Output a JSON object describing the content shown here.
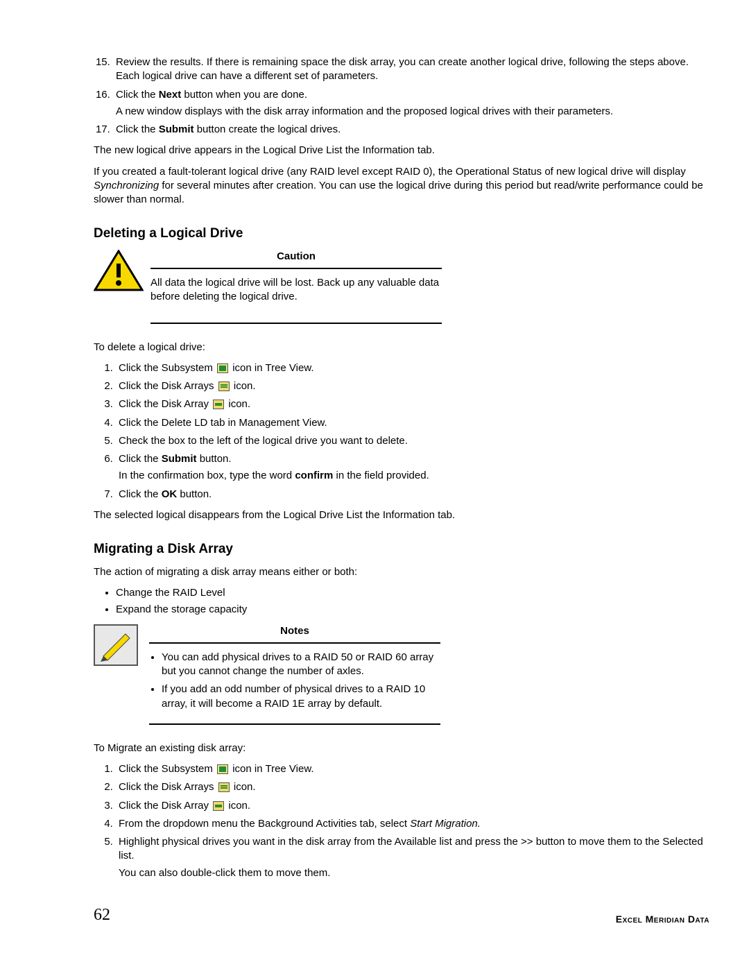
{
  "steps_top": {
    "start": 15,
    "items": [
      {
        "text": "Review the results. If there is remaining space the disk array, you can create another logical drive, following the steps above. Each logical drive can have a different set of parameters."
      },
      {
        "pre": "Click the ",
        "bold": "Next",
        "post": " button when you are done.",
        "sub": "A new window displays with the disk array information and the proposed logical drives with their parameters."
      },
      {
        "pre": "Click the ",
        "bold": "Submit",
        "post": " button create the logical drives."
      }
    ]
  },
  "para_after_top_1": "The new logical drive appears in the Logical Drive List the Information tab.",
  "para_after_top_2": {
    "pre": "If you created a fault-tolerant logical drive (any RAID level except RAID 0), the Operational Status of new logical drive will display ",
    "italic": "Synchronizing",
    "post": " for several minutes after creation. You can use the logical drive during this period but read/write performance could be slower than normal."
  },
  "heading_delete": "Deleting a Logical Drive",
  "caution": {
    "title": "Caution",
    "text": "All data the logical drive will be lost. Back up any valuable data before deleting the logical drive."
  },
  "delete_intro": "To delete a logical drive:",
  "delete_steps": [
    {
      "pre": "Click the Subsystem ",
      "icon": "subsystem",
      "post": " icon in Tree View."
    },
    {
      "pre": "Click the Disk Arrays ",
      "icon": "disk-arrays",
      "post": " icon."
    },
    {
      "pre": "Click the Disk Array ",
      "icon": "disk-array",
      "post": " icon."
    },
    {
      "text": "Click the Delete LD tab in Management View."
    },
    {
      "text": "Check the box to the left of the logical drive you want to delete."
    },
    {
      "pre": "Click the ",
      "bold": "Submit",
      "post": " button.",
      "sub_pre": "In the confirmation box, type the word ",
      "sub_bold": "confirm",
      "sub_post": " in the field provided."
    },
    {
      "pre": "Click the ",
      "bold": "OK",
      "post": " button."
    }
  ],
  "delete_after": "The selected logical disappears from the Logical Drive List the Information tab.",
  "heading_migrate": "Migrating a Disk Array",
  "migrate_intro": "The action of migrating a disk array means either or both:",
  "migrate_bullets": [
    "Change the RAID Level",
    "Expand the storage capacity"
  ],
  "notes": {
    "title": "Notes",
    "items": [
      "You can add physical drives to a RAID 50 or RAID 60 array but you cannot change the number of axles.",
      "If you add an odd number of physical drives to a RAID 10 array, it will become a RAID 1E array by default."
    ]
  },
  "migrate_howto": "To Migrate an existing disk array:",
  "migrate_steps": [
    {
      "pre": "Click the Subsystem ",
      "icon": "subsystem",
      "post": " icon in Tree View."
    },
    {
      "pre": "Click the Disk Arrays ",
      "icon": "disk-arrays",
      "post": " icon."
    },
    {
      "pre": "Click the Disk Array ",
      "icon": "disk-array",
      "post": " icon."
    },
    {
      "pre": "From the dropdown menu the Background Activities tab, select ",
      "italic": "Start Migration."
    },
    {
      "text": "Highlight physical drives you want in the disk array from the Available list and press the >> button to move them to the Selected list.",
      "sub": "You can also double-click them to move them."
    }
  ],
  "footer": {
    "page": "62",
    "brand": "Excel Meridian Data"
  }
}
